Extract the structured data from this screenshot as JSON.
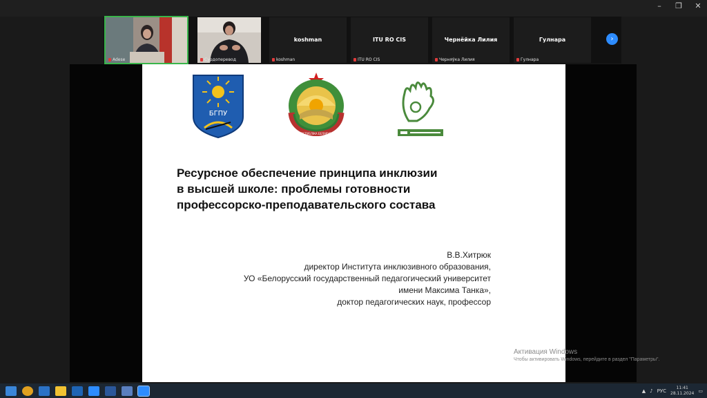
{
  "window": {
    "controls": [
      "–",
      "❐",
      "✕"
    ]
  },
  "gallery": {
    "tiles": [
      {
        "id": "adese",
        "label": "Adese",
        "center_name": "",
        "has_video": true,
        "active": true
      },
      {
        "id": "sudo",
        "label": "Сурдоперевод",
        "center_name": "",
        "has_video": true,
        "active": false
      },
      {
        "id": "koshman",
        "label": "koshman",
        "center_name": "koshman",
        "has_video": false,
        "active": false
      },
      {
        "id": "itu",
        "label": "ITU RO CIS",
        "center_name": "ITU RO CIS",
        "has_video": false,
        "active": false
      },
      {
        "id": "cherneyka",
        "label": "Черняўка Лилия",
        "center_name": "Чернёйка Лилия",
        "has_video": false,
        "active": false
      },
      {
        "id": "gulnara",
        "label": "Гулнара",
        "center_name": "Гулнара",
        "has_video": false,
        "active": false
      }
    ],
    "next_icon": "chevron-right-icon"
  },
  "slide": {
    "logo_badge_text": "БГПУ",
    "emblem_ribbon_text": "РЭСПУБЛIКА БЕЛАРУСЬ",
    "title_lines": [
      "Ресурсное обеспечение принципа инклюзии",
      "в высшей школе: проблемы готовности",
      "профессорско-преподавательского состава"
    ],
    "author_lines": [
      "В.В.Хитрюк",
      "директор Института инклюзивного образования,",
      "УО «Белорусский государственный педагогический университет",
      "имени Максима Танка»,",
      "доктор педагогических наук, профессор"
    ]
  },
  "watermark": {
    "line1": "Активация Windows",
    "line2": "Чтобы активировать Windows, перейдите в раздел \"Параметры\"."
  },
  "taskbar": {
    "apps": [
      "start",
      "search",
      "chrome",
      "explorer",
      "store",
      "outlook",
      "zoom",
      "word",
      "app",
      "zoom-active"
    ],
    "tray": {
      "lang": "РУС",
      "time": "11:41",
      "date": "28.11.2024"
    }
  }
}
